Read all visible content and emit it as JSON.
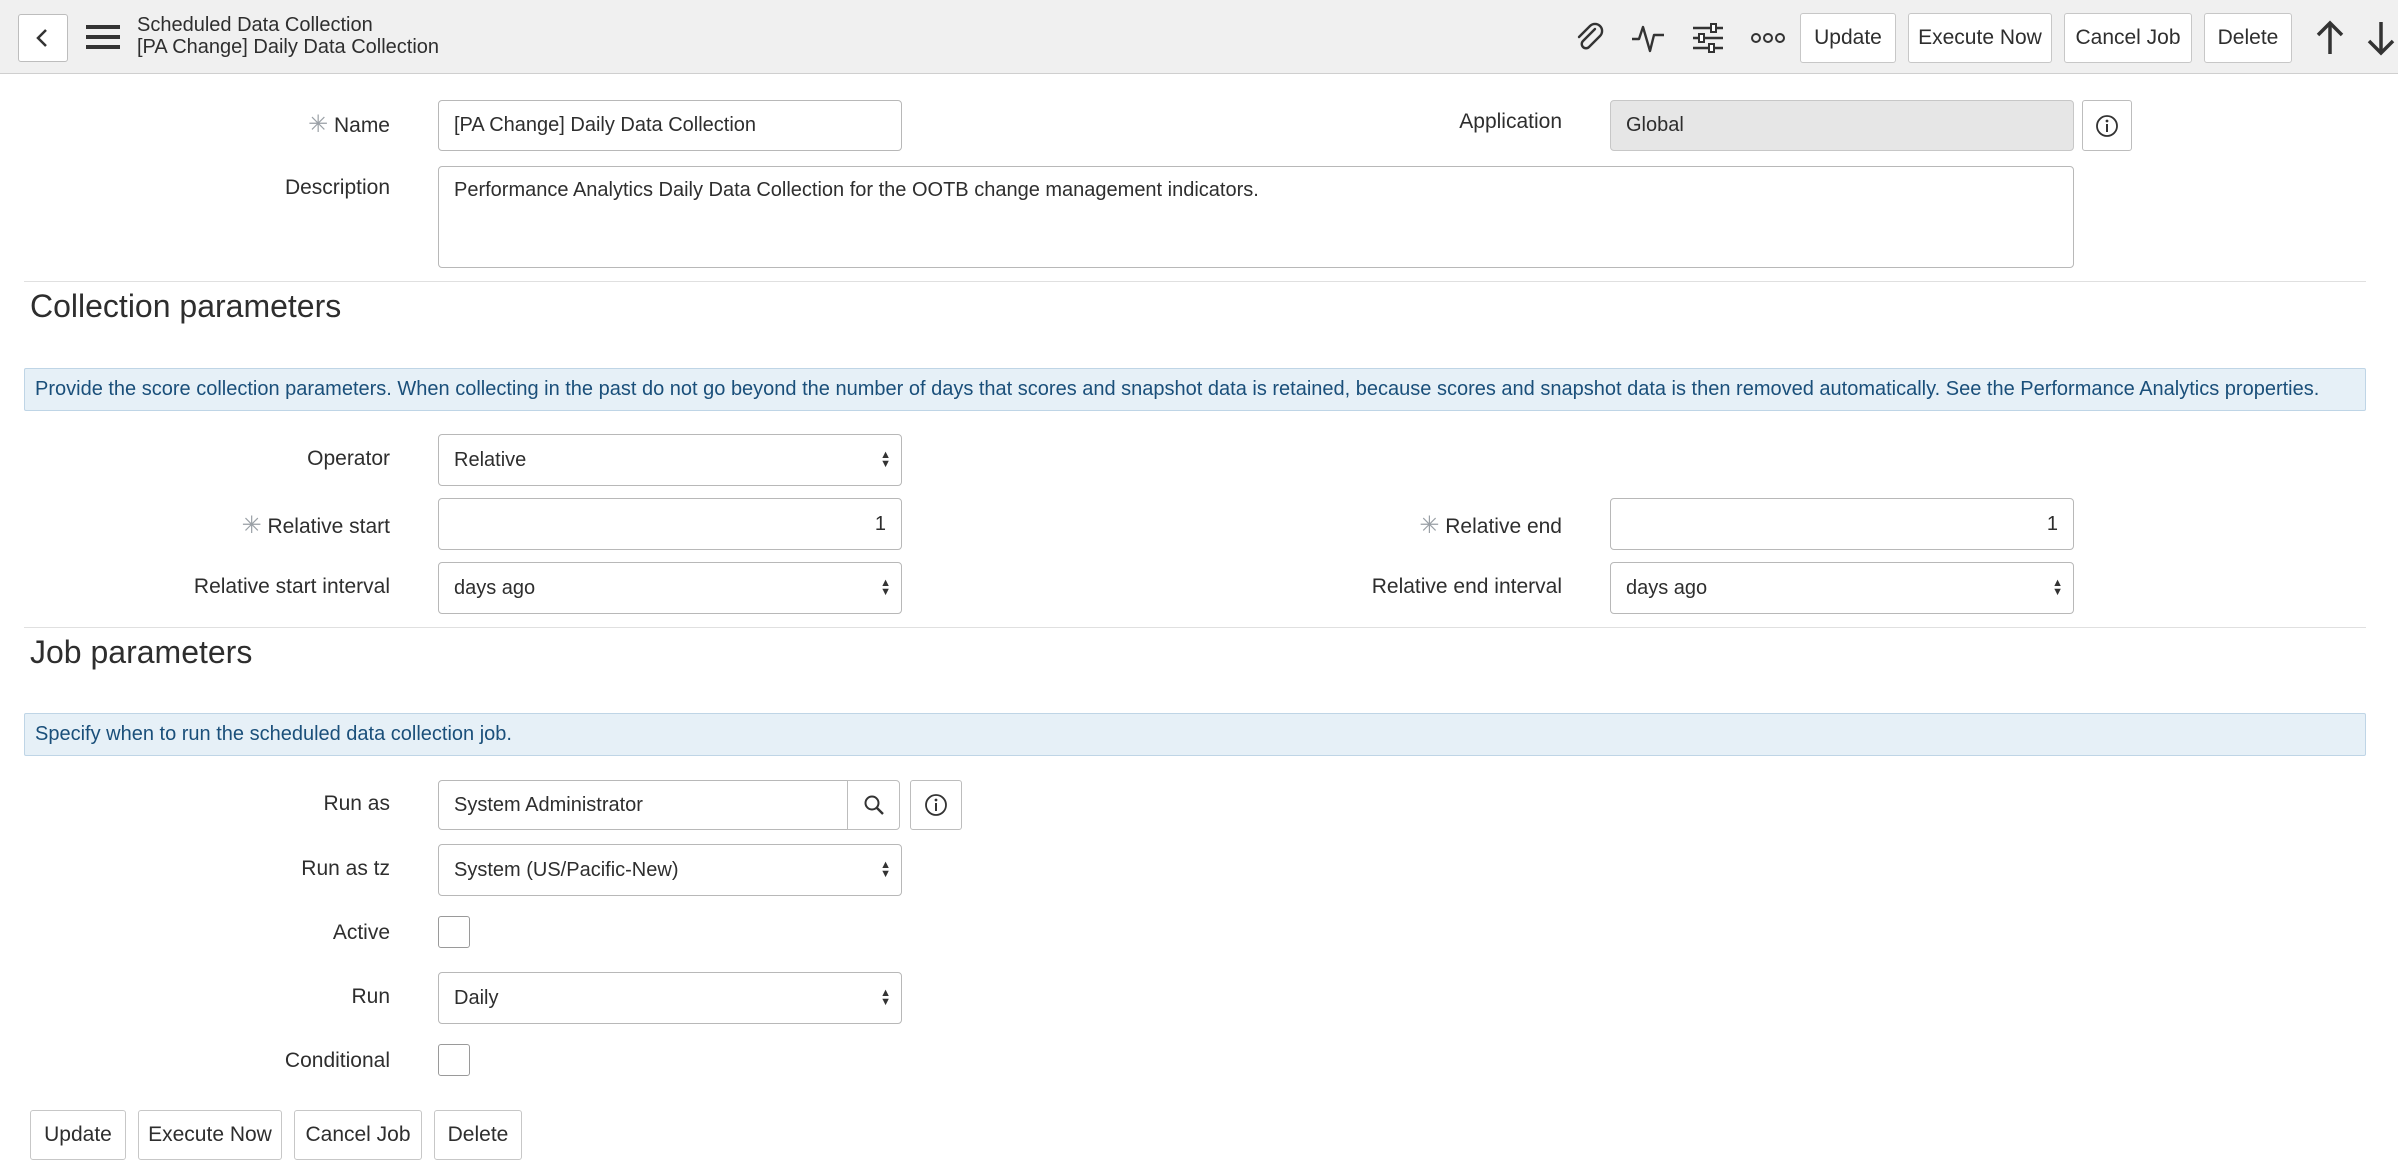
{
  "header": {
    "title": "Scheduled Data Collection",
    "subtitle": "[PA Change] Daily Data Collection",
    "buttons": {
      "update": "Update",
      "execute_now": "Execute Now",
      "cancel_job": "Cancel Job",
      "delete": "Delete"
    },
    "icons": [
      "back-icon",
      "menu-icon",
      "paperclip-icon",
      "activity-icon",
      "settings-sliders-icon",
      "more-icon",
      "arrow-up-icon",
      "arrow-down-icon"
    ]
  },
  "form": {
    "name": {
      "label": "Name",
      "value": "[PA Change] Daily Data Collection"
    },
    "application": {
      "label": "Application",
      "value": "Global"
    },
    "description": {
      "label": "Description",
      "value": "Performance Analytics Daily Data Collection for the OOTB change management indicators."
    }
  },
  "collection": {
    "title": "Collection parameters",
    "info": "Provide the score collection parameters. When collecting in the past do not go beyond the number of days that scores and snapshot data is retained, because scores and snapshot data is then removed automatically. See the Performance Analytics properties.",
    "operator": {
      "label": "Operator",
      "value": "Relative"
    },
    "relative_start": {
      "label": "Relative start",
      "value": "1"
    },
    "relative_end": {
      "label": "Relative end",
      "value": "1"
    },
    "relative_start_interval": {
      "label": "Relative start interval",
      "value": "days ago"
    },
    "relative_end_interval": {
      "label": "Relative end interval",
      "value": "days ago"
    }
  },
  "job": {
    "title": "Job parameters",
    "info": "Specify when to run the scheduled data collection job.",
    "run_as": {
      "label": "Run as",
      "value": "System Administrator"
    },
    "run_as_tz": {
      "label": "Run as tz",
      "value": "System (US/Pacific-New)"
    },
    "active": {
      "label": "Active",
      "checked": false
    },
    "run": {
      "label": "Run",
      "value": "Daily"
    },
    "conditional": {
      "label": "Conditional",
      "checked": false
    }
  },
  "footer": {
    "buttons": {
      "update": "Update",
      "execute_now": "Execute Now",
      "cancel_job": "Cancel Job",
      "delete": "Delete"
    }
  },
  "colors": {
    "info_bg": "#e6f0f7",
    "info_text": "#1a4f7a",
    "header_bg": "#f0f0f0"
  }
}
